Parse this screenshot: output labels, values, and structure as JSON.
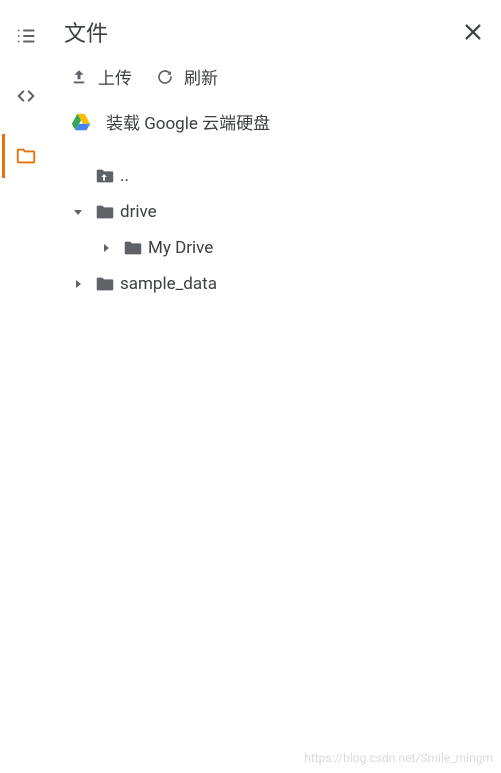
{
  "header": {
    "title": "文件"
  },
  "toolbar": {
    "upload_label": "上传",
    "refresh_label": "刷新"
  },
  "mount": {
    "label": "装载 Google 云端硬盘"
  },
  "tree": {
    "parent_label": "..",
    "items": [
      {
        "name": "drive",
        "expanded": true,
        "children": [
          {
            "name": "My Drive",
            "expanded": false
          }
        ]
      },
      {
        "name": "sample_data",
        "expanded": false
      }
    ]
  },
  "watermark": "https://blog.csdn.net/Smile_mingm",
  "colors": {
    "accent": "#e8710a",
    "folder_dark": "#5f6368"
  }
}
